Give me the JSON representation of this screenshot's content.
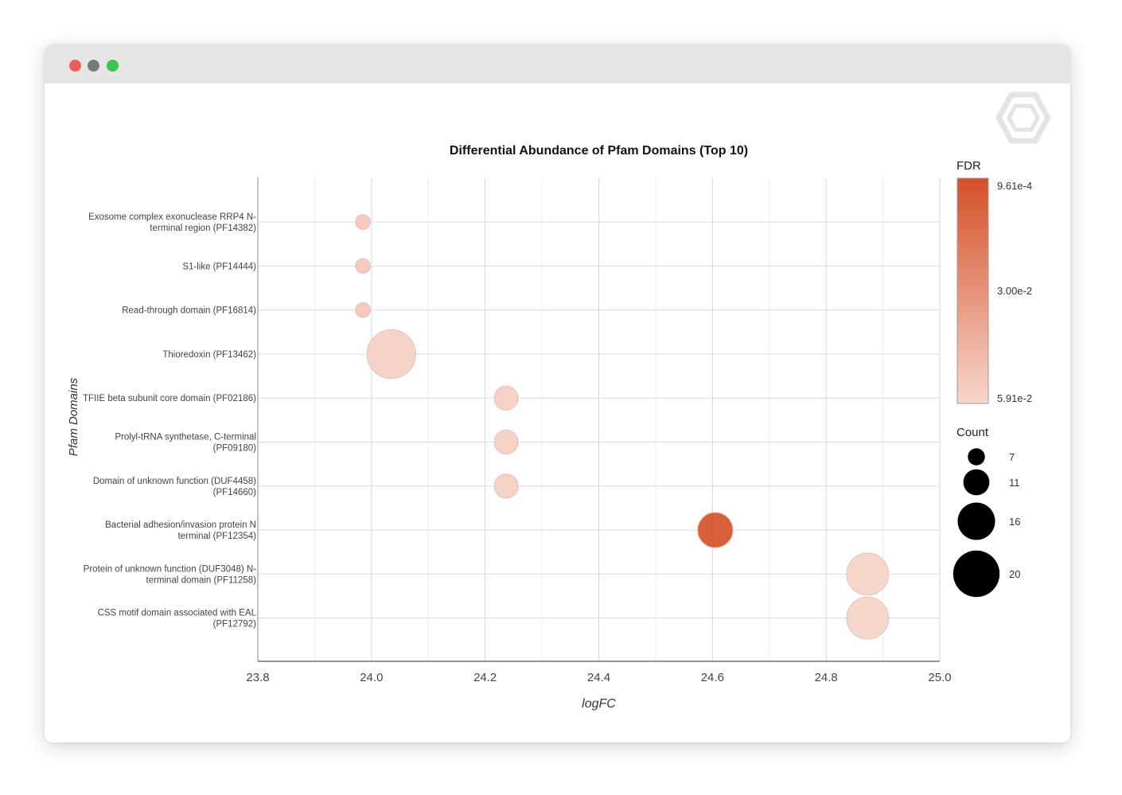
{
  "window": {
    "buttons": [
      "close",
      "minimize",
      "maximize"
    ]
  },
  "colors": {
    "fdr_high": "#d45028",
    "fdr_low": "#f7d6cc",
    "grid": "#dedede",
    "axis": "#555555",
    "titlebar": "#e6e6e6"
  },
  "logo_icon": "hexagon-logo-icon",
  "chart_data": {
    "type": "scatter",
    "title": "Differential Abundance of Pfam Domains (Top 10)",
    "xlabel": "logFC",
    "ylabel": "Pfam Domains",
    "xlim": [
      23.8,
      25.0
    ],
    "xticks": [
      "23.8",
      "24.0",
      "24.2",
      "24.4",
      "24.6",
      "24.8",
      "25.0"
    ],
    "grid": true,
    "categories": [
      [
        "Exosome complex exonuclease RRP4 N-",
        "terminal region (PF14382)"
      ],
      [
        "S1-like (PF14444)"
      ],
      [
        "Read-through domain (PF16814)"
      ],
      [
        "Thioredoxin (PF13462)"
      ],
      [
        "TFIIE beta subunit core domain (PF02186)"
      ],
      [
        "Prolyl-tRNA synthetase, C-terminal",
        "(PF09180)"
      ],
      [
        "Domain of unknown function (DUF4458)",
        "(PF14660)"
      ],
      [
        "Bacterial adhesion/invasion protein N",
        "terminal (PF12354)"
      ],
      [
        "Protein of unknown function (DUF3048) N-",
        "terminal domain (PF11258)"
      ],
      [
        "CSS motif domain associated with EAL",
        "(PF12792)"
      ]
    ],
    "points": [
      {
        "logFC": 23.985,
        "count": 5,
        "fdr": 0.052
      },
      {
        "logFC": 23.985,
        "count": 5,
        "fdr": 0.052
      },
      {
        "logFC": 23.985,
        "count": 5,
        "fdr": 0.052
      },
      {
        "logFC": 24.035,
        "count": 20,
        "fdr": 0.056
      },
      {
        "logFC": 24.237,
        "count": 9,
        "fdr": 0.055
      },
      {
        "logFC": 24.237,
        "count": 9,
        "fdr": 0.055
      },
      {
        "logFC": 24.237,
        "count": 9,
        "fdr": 0.055
      },
      {
        "logFC": 24.605,
        "count": 14,
        "fdr": 0.0012
      },
      {
        "logFC": 24.873,
        "count": 17,
        "fdr": 0.0575
      },
      {
        "logFC": 24.873,
        "count": 17,
        "fdr": 0.0575
      }
    ],
    "color_legend": {
      "title": "FDR",
      "labels": [
        "9.61e-4",
        "3.00e-2",
        "5.91e-2"
      ],
      "values": [
        0.000961,
        0.03,
        0.0591
      ]
    },
    "size_legend": {
      "title": "Count",
      "labels": [
        "7",
        "11",
        "16",
        "20"
      ],
      "values": [
        7,
        11,
        16,
        20
      ]
    },
    "legend_position": "right"
  }
}
